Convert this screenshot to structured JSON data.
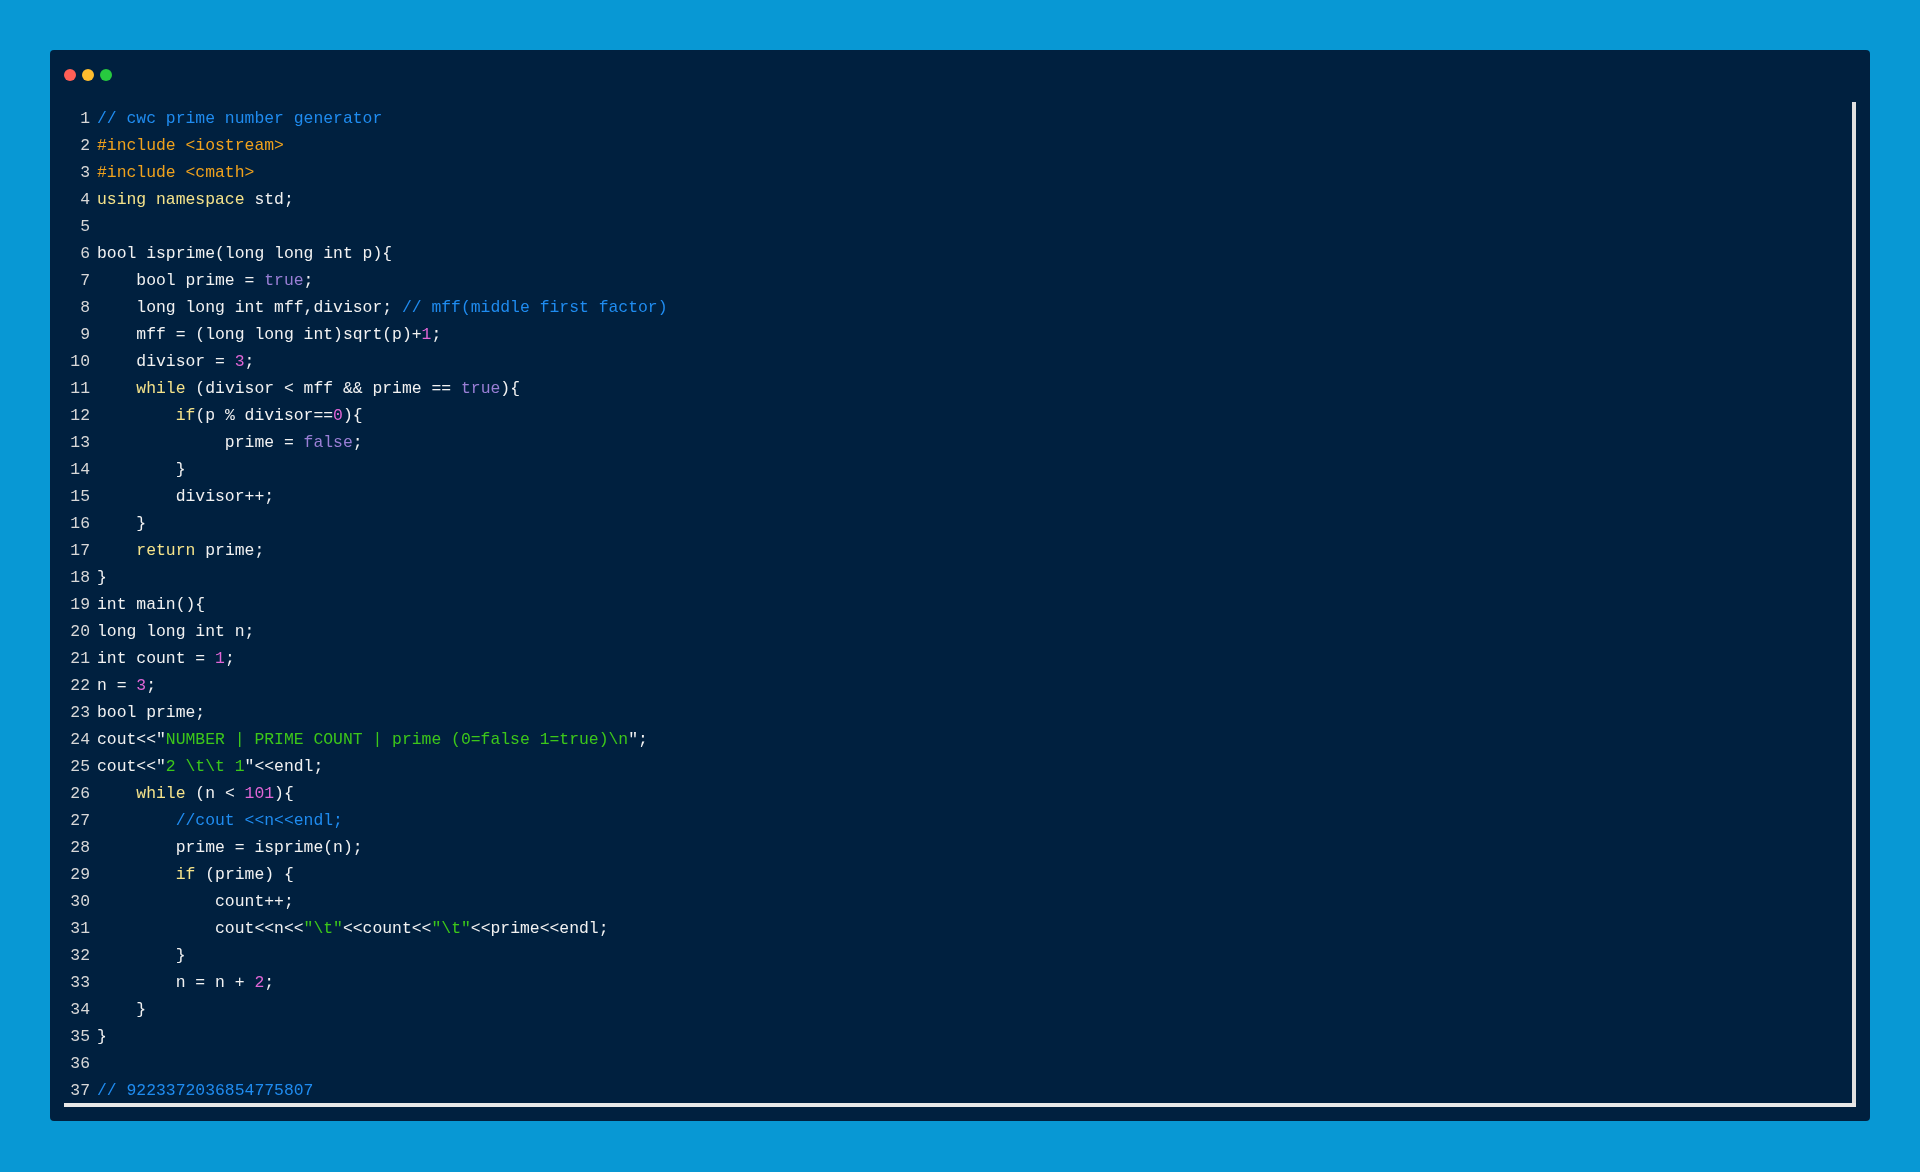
{
  "window": {
    "controls": [
      {
        "kind": "close"
      },
      {
        "kind": "minimize"
      },
      {
        "kind": "maximize"
      }
    ]
  },
  "code": {
    "lines": [
      {
        "number": "1",
        "tokens": [
          {
            "text": "// cwc prime number generator",
            "kind": "comment"
          }
        ]
      },
      {
        "number": "2",
        "tokens": [
          {
            "text": "#include <iostream>",
            "kind": "preprocessor"
          }
        ]
      },
      {
        "number": "3",
        "tokens": [
          {
            "text": "#include <cmath>",
            "kind": "preprocessor"
          }
        ]
      },
      {
        "number": "4",
        "tokens": [
          {
            "text": "using namespace",
            "kind": "keyword"
          },
          {
            "text": " std;",
            "kind": "plain"
          }
        ]
      },
      {
        "number": "5"
      },
      {
        "number": "6",
        "tokens": [
          {
            "text": "bool isprime(long long int p){",
            "kind": "plain"
          }
        ]
      },
      {
        "number": "7",
        "tokens": [
          {
            "text": "    bool prime = ",
            "kind": "plain"
          },
          {
            "text": "true",
            "kind": "literal"
          },
          {
            "text": ";",
            "kind": "plain"
          }
        ]
      },
      {
        "number": "8",
        "tokens": [
          {
            "text": "    long long int mff,divisor; ",
            "kind": "plain"
          },
          {
            "text": "// mff(middle first factor)",
            "kind": "comment"
          }
        ]
      },
      {
        "number": "9",
        "tokens": [
          {
            "text": "    mff = (long long int)sqrt(p)+",
            "kind": "plain"
          },
          {
            "text": "1",
            "kind": "number"
          },
          {
            "text": ";",
            "kind": "plain"
          }
        ]
      },
      {
        "number": "10",
        "tokens": [
          {
            "text": "    divisor = ",
            "kind": "plain"
          },
          {
            "text": "3",
            "kind": "number"
          },
          {
            "text": ";",
            "kind": "plain"
          }
        ]
      },
      {
        "number": "11",
        "tokens": [
          {
            "text": "    while",
            "kind": "keyword"
          },
          {
            "text": " (divisor < mff && prime == ",
            "kind": "plain"
          },
          {
            "text": "true",
            "kind": "literal"
          },
          {
            "text": "){",
            "kind": "plain"
          }
        ]
      },
      {
        "number": "12",
        "tokens": [
          {
            "text": "        if",
            "kind": "keyword"
          },
          {
            "text": "(p % divisor==",
            "kind": "plain"
          },
          {
            "text": "0",
            "kind": "number"
          },
          {
            "text": "){",
            "kind": "plain"
          }
        ]
      },
      {
        "number": "13",
        "tokens": [
          {
            "text": "             prime = ",
            "kind": "plain"
          },
          {
            "text": "false",
            "kind": "literal"
          },
          {
            "text": ";",
            "kind": "plain"
          }
        ]
      },
      {
        "number": "14",
        "tokens": [
          {
            "text": "        }",
            "kind": "plain"
          }
        ]
      },
      {
        "number": "15",
        "tokens": [
          {
            "text": "        divisor++;",
            "kind": "plain"
          }
        ]
      },
      {
        "number": "16",
        "tokens": [
          {
            "text": "    }",
            "kind": "plain"
          }
        ]
      },
      {
        "number": "17",
        "tokens": [
          {
            "text": "    return",
            "kind": "keyword"
          },
          {
            "text": " prime;",
            "kind": "plain"
          }
        ]
      },
      {
        "number": "18",
        "tokens": [
          {
            "text": "}",
            "kind": "plain"
          }
        ]
      },
      {
        "number": "19",
        "tokens": [
          {
            "text": "int main(){",
            "kind": "plain"
          }
        ]
      },
      {
        "number": "20",
        "tokens": [
          {
            "text": "long long int n;",
            "kind": "plain"
          }
        ]
      },
      {
        "number": "21",
        "tokens": [
          {
            "text": "int count = ",
            "kind": "plain"
          },
          {
            "text": "1",
            "kind": "number"
          },
          {
            "text": ";",
            "kind": "plain"
          }
        ]
      },
      {
        "number": "22",
        "tokens": [
          {
            "text": "n = ",
            "kind": "plain"
          },
          {
            "text": "3",
            "kind": "number"
          },
          {
            "text": ";",
            "kind": "plain"
          }
        ]
      },
      {
        "number": "23",
        "tokens": [
          {
            "text": "bool prime;",
            "kind": "plain"
          }
        ]
      },
      {
        "number": "24",
        "tokens": [
          {
            "text": "cout<<\"",
            "kind": "plain"
          },
          {
            "text": "NUMBER | PRIME COUNT | prime (0=false 1=true)\\n",
            "kind": "string"
          },
          {
            "text": "\";",
            "kind": "plain"
          }
        ]
      },
      {
        "number": "25",
        "tokens": [
          {
            "text": "cout<<\"",
            "kind": "plain"
          },
          {
            "text": "2 \\t\\t 1",
            "kind": "string"
          },
          {
            "text": "\"<<endl;",
            "kind": "plain"
          }
        ]
      },
      {
        "number": "26",
        "tokens": [
          {
            "text": "    while",
            "kind": "keyword"
          },
          {
            "text": " (n < ",
            "kind": "plain"
          },
          {
            "text": "101",
            "kind": "number"
          },
          {
            "text": "){",
            "kind": "plain"
          }
        ]
      },
      {
        "number": "27",
        "tokens": [
          {
            "text": "        //cout <<n<<endl;",
            "kind": "comment"
          }
        ]
      },
      {
        "number": "28",
        "tokens": [
          {
            "text": "        prime = isprime(n);",
            "kind": "plain"
          }
        ]
      },
      {
        "number": "29",
        "tokens": [
          {
            "text": "        if",
            "kind": "keyword"
          },
          {
            "text": " (prime) {",
            "kind": "plain"
          }
        ]
      },
      {
        "number": "30",
        "tokens": [
          {
            "text": "            count++;",
            "kind": "plain"
          }
        ]
      },
      {
        "number": "31",
        "tokens": [
          {
            "text": "            cout<<n<<",
            "kind": "plain"
          },
          {
            "text": "\"\\t\"",
            "kind": "string"
          },
          {
            "text": "<<count<<",
            "kind": "plain"
          },
          {
            "text": "\"\\t\"",
            "kind": "string"
          },
          {
            "text": "<<prime<<endl;",
            "kind": "plain"
          }
        ]
      },
      {
        "number": "32",
        "tokens": [
          {
            "text": "        }",
            "kind": "plain"
          }
        ]
      },
      {
        "number": "33",
        "tokens": [
          {
            "text": "        n = n + ",
            "kind": "plain"
          },
          {
            "text": "2",
            "kind": "number"
          },
          {
            "text": ";",
            "kind": "plain"
          }
        ]
      },
      {
        "number": "34",
        "tokens": [
          {
            "text": "    }",
            "kind": "plain"
          }
        ]
      },
      {
        "number": "35",
        "tokens": [
          {
            "text": "}",
            "kind": "plain"
          }
        ]
      },
      {
        "number": "36"
      },
      {
        "number": "37",
        "tokens": [
          {
            "text": "// 9223372036854775807",
            "kind": "comment"
          }
        ]
      }
    ]
  }
}
